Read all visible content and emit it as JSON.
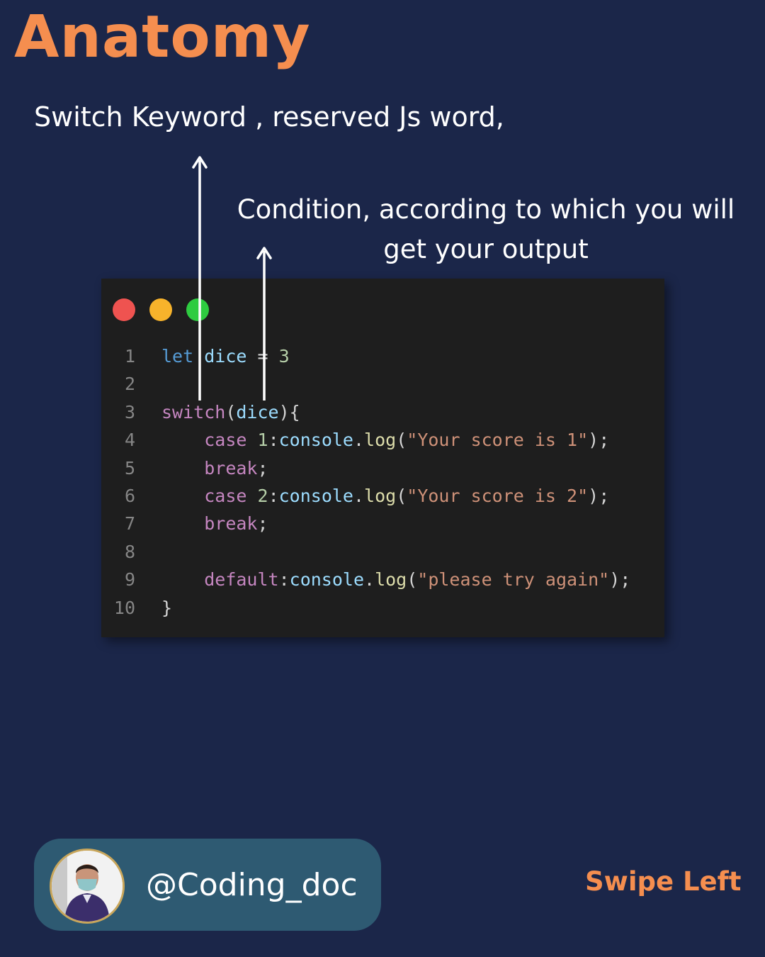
{
  "title": "Anatomy",
  "annotations": {
    "switch_keyword": "Switch Keyword , reserved Js word,",
    "condition_line1": "Condition, according to which you will",
    "condition_line2": "get your output"
  },
  "code": {
    "line_numbers": [
      "1",
      "2",
      "3",
      "4",
      "5",
      "6",
      "7",
      "8",
      "9",
      "10"
    ],
    "l1": {
      "let": "let",
      "var": "dice",
      "eq": " = ",
      "num": "3"
    },
    "l3": {
      "switch": "switch",
      "open": "(",
      "var": "dice",
      "close": "){"
    },
    "l4": {
      "case": "case",
      "num": "1",
      "colon": ":",
      "obj": "console",
      "dot": ".",
      "fn": "log",
      "open": "(",
      "str": "\"Your score is 1\"",
      "close": ");"
    },
    "l5": {
      "break": "break",
      "semi": ";"
    },
    "l6": {
      "case": "case",
      "num": "2",
      "colon": ":",
      "obj": "console",
      "dot": ".",
      "fn": "log",
      "open": "(",
      "str": "\"Your score is 2\"",
      "close": ");"
    },
    "l7": {
      "break": "break",
      "semi": ";"
    },
    "l9": {
      "default": "default",
      "colon": ":",
      "obj": "console",
      "dot": ".",
      "fn": "log",
      "open": "(",
      "str": "\"please try again\"",
      "close": ");"
    },
    "l10": {
      "brace": "}"
    }
  },
  "profile": {
    "handle": "@Coding_doc"
  },
  "swipe_label": "Swipe Left",
  "colors": {
    "background": "#1b2649",
    "accent": "#f58e4f",
    "editor_bg": "#1e1e1e",
    "profile_pill": "#2e5a72"
  },
  "icons": [
    "window-close-dot",
    "window-minimize-dot",
    "window-maximize-dot",
    "arrow-up-icon"
  ]
}
